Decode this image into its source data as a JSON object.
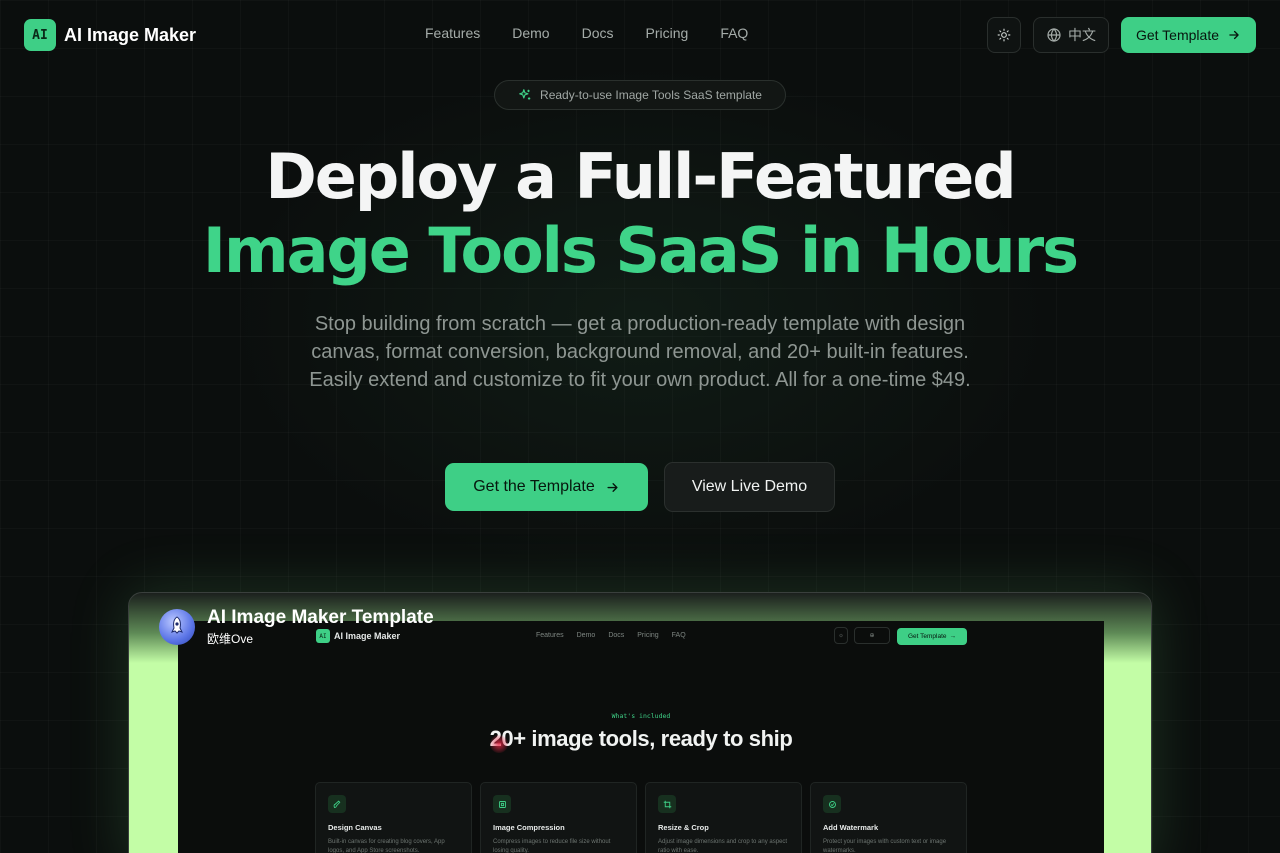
{
  "nav": {
    "logo_text": "AI",
    "brand": "AI Image Maker",
    "links": [
      "Features",
      "Demo",
      "Docs",
      "Pricing",
      "FAQ"
    ],
    "theme_icon": "sun-icon",
    "lang_label": "中文",
    "cta_label": "Get Template"
  },
  "hero": {
    "badge": "Ready-to-use Image Tools SaaS template",
    "title_line1": "Deploy a Full-Featured",
    "title_line2": "Image Tools SaaS in Hours",
    "subtitle": "Stop building from scratch — get a production-ready template with design canvas, format conversion, background removal, and 20+ built-in features. Easily extend and customize to fit your own product. All for a one-time $49.",
    "primary_button": "Get the Template",
    "secondary_button": "View Live Demo"
  },
  "video": {
    "title": "AI Image Maker Template",
    "channel": "欧维Ove",
    "inner_nav": {
      "logo_text": "AI",
      "brand": "AI Image Maker",
      "links": [
        "Features",
        "Demo",
        "Docs",
        "Pricing",
        "FAQ"
      ],
      "cta_label": "Get Template"
    },
    "eyebrow": "What's included",
    "heading": "20+ image tools, ready to ship",
    "cards": [
      {
        "title": "Design Canvas",
        "desc": "Built-in canvas for creating blog covers, App logos, and App Store screenshots."
      },
      {
        "title": "Image Compression",
        "desc": "Compress images to reduce file size without losing quality."
      },
      {
        "title": "Resize & Crop",
        "desc": "Adjust image dimensions and crop to any aspect ratio with ease."
      },
      {
        "title": "Add Watermark",
        "desc": "Protect your images with custom text or image watermarks."
      }
    ]
  },
  "colors": {
    "accent": "#3ecf86",
    "background": "#0b0e0d",
    "preview_glow": "#c3fda6"
  }
}
